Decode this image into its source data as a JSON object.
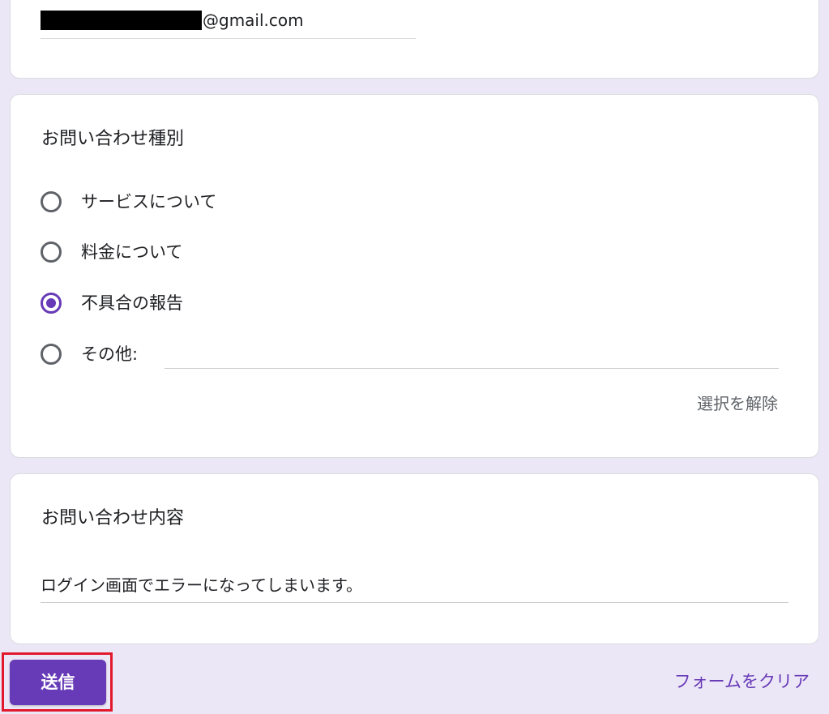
{
  "email_question": {
    "value_suffix": "@gmail.com"
  },
  "type_question": {
    "title": "お問い合わせ種別",
    "options": [
      {
        "label": "サービスについて",
        "selected": false
      },
      {
        "label": "料金について",
        "selected": false
      },
      {
        "label": "不具合の報告",
        "selected": true
      },
      {
        "label": "その他:",
        "selected": false
      }
    ],
    "other_value": "",
    "clear_selection_label": "選択を解除"
  },
  "content_question": {
    "title": "お問い合わせ内容",
    "answer": "ログイン画面でエラーになってしまいます。"
  },
  "footer": {
    "submit_label": "送信",
    "clear_form_label": "フォームをクリア"
  },
  "colors": {
    "accent": "#673ab7",
    "background": "#ece7f7",
    "highlight": "#e2192d"
  }
}
